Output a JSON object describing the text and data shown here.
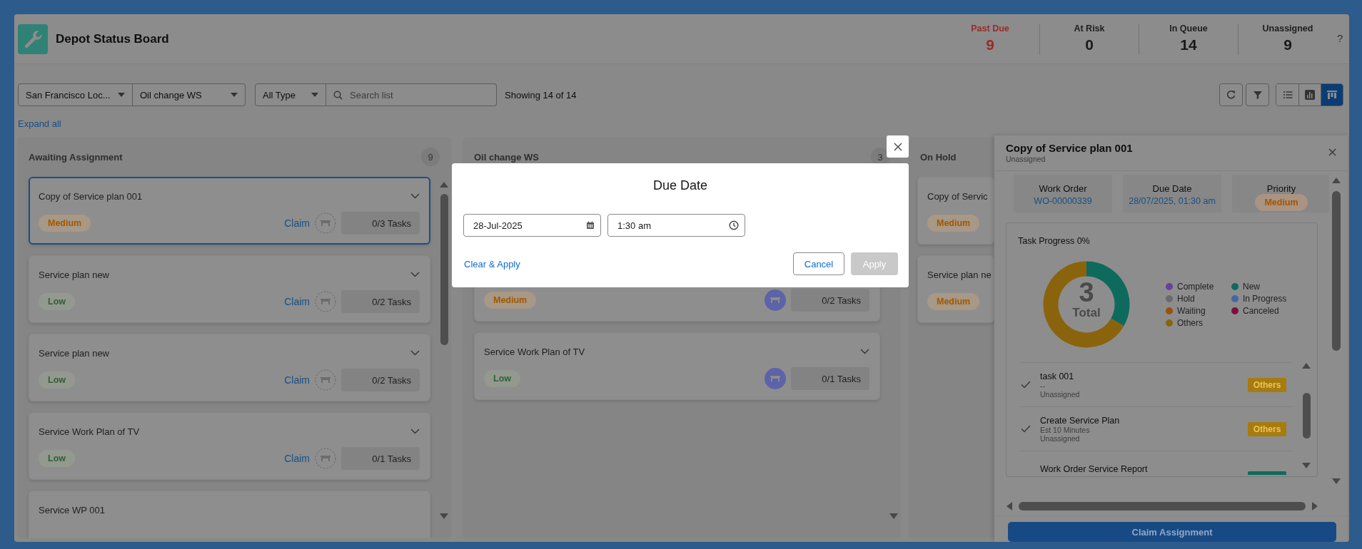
{
  "app": {
    "title": "Depot Status Board"
  },
  "stats": [
    {
      "label": "Past Due",
      "value": "9",
      "kind": "alert"
    },
    {
      "label": "At Risk",
      "value": "0",
      "kind": "normal"
    },
    {
      "label": "In Queue",
      "value": "14",
      "kind": "normal"
    },
    {
      "label": "Unassigned",
      "value": "9",
      "kind": "normal"
    }
  ],
  "help": "?",
  "filters": {
    "location": "San Francisco Loc...",
    "station": "Oil change WS",
    "type": "All Type",
    "search_placeholder": "Search list",
    "count": "Showing 14 of 14"
  },
  "toolbar": [
    {
      "kind": "refresh",
      "selected": false
    },
    {
      "kind": "filter",
      "selected": false
    },
    {
      "kind": "list",
      "selected": false
    },
    {
      "kind": "chart",
      "selected": false
    },
    {
      "kind": "board",
      "selected": true
    }
  ],
  "expand_all": "Expand all",
  "columns": [
    {
      "title": "Awaiting Assignment",
      "count": "9",
      "cards": [
        {
          "title": "Copy of Service plan 001",
          "selected": true,
          "priority": {
            "label": "Medium",
            "color": "#a05800"
          },
          "claim": "Claim",
          "assigned": false,
          "tasks": "0/3 Tasks"
        },
        {
          "title": "Service plan new",
          "selected": false,
          "priority": {
            "label": "Low",
            "color": "#2f5f36"
          },
          "claim": "Claim",
          "assigned": false,
          "tasks": "0/2 Tasks"
        },
        {
          "title": "Service plan new",
          "selected": false,
          "priority": {
            "label": "Low",
            "color": "#2f5f36"
          },
          "claim": "Claim",
          "assigned": false,
          "tasks": "0/2 Tasks"
        },
        {
          "title": "Service Work Plan of TV",
          "selected": false,
          "priority": {
            "label": "Low",
            "color": "#2f5f36"
          },
          "claim": "Claim",
          "assigned": false,
          "tasks": "0/1 Tasks"
        },
        {
          "title": "Service WP 001",
          "selected": false
        }
      ]
    },
    {
      "title": "Oil change WS",
      "count": "3",
      "cards": [
        {
          "selected": false,
          "priority": {
            "label": "Medium",
            "color": "#a05800"
          },
          "assigned": true,
          "tasks": "0/2 Tasks"
        },
        {
          "title": "Service Work Plan of TV",
          "selected": false,
          "priority": {
            "label": "Low",
            "color": "#2f5f36"
          },
          "assigned": true,
          "tasks": "0/1 Tasks"
        }
      ]
    },
    {
      "title": "On Hold",
      "cards": [
        {
          "title": "Copy of Servic",
          "selected": false,
          "priority": {
            "label": "Medium",
            "color": "#a05800"
          }
        },
        {
          "title": "Service plan ne",
          "selected": false,
          "priority": {
            "label": "Medium",
            "color": "#a05800"
          }
        }
      ]
    }
  ],
  "detail_panel": {
    "title": "Copy of Service plan 001",
    "subtitle": "Unassigned",
    "fields": [
      {
        "label": "Work Order",
        "value": "WO-00000339",
        "kind": "link"
      },
      {
        "label": "Due Date",
        "value": "28/07/2025, 01:30 am",
        "kind": "link"
      },
      {
        "label": "Priority",
        "value": "Medium",
        "kind": "badge"
      }
    ],
    "progress": {
      "title": "Task Progress 0%",
      "total": "3",
      "total_label": "Total",
      "legend": [
        {
          "label": "Complete",
          "color": "#6a3f9e"
        },
        {
          "label": "Hold",
          "color": "#6b6b6b"
        },
        {
          "label": "Waiting",
          "color": "#9a5208"
        },
        {
          "label": "Others",
          "color": "#8a640c"
        },
        {
          "label": "New",
          "color": "#0f6a5e"
        },
        {
          "label": "In Progress",
          "color": "#4366a6"
        },
        {
          "label": "Canceled",
          "color": "#7d0f40"
        }
      ],
      "tasks": [
        {
          "name": "task 001",
          "lines": [
            "--",
            "Unassigned"
          ],
          "checked": true,
          "status": "Others",
          "color": "#a67c0e"
        },
        {
          "name": "Create Service Plan",
          "lines": [
            "Est 10 Minutes",
            "Unassigned"
          ],
          "checked": true,
          "status": "Others",
          "color": "#a67c0e"
        },
        {
          "name": "Work Order Service Report",
          "checked": false,
          "color": "#0f6a5e"
        }
      ]
    },
    "action": "Claim Assignment"
  },
  "modal": {
    "title": "Due Date",
    "date": "28-Jul-2025",
    "time": "1:30 am",
    "clear_apply": "Clear & Apply",
    "cancel": "Cancel",
    "apply": "Apply",
    "apply_disabled": true
  }
}
